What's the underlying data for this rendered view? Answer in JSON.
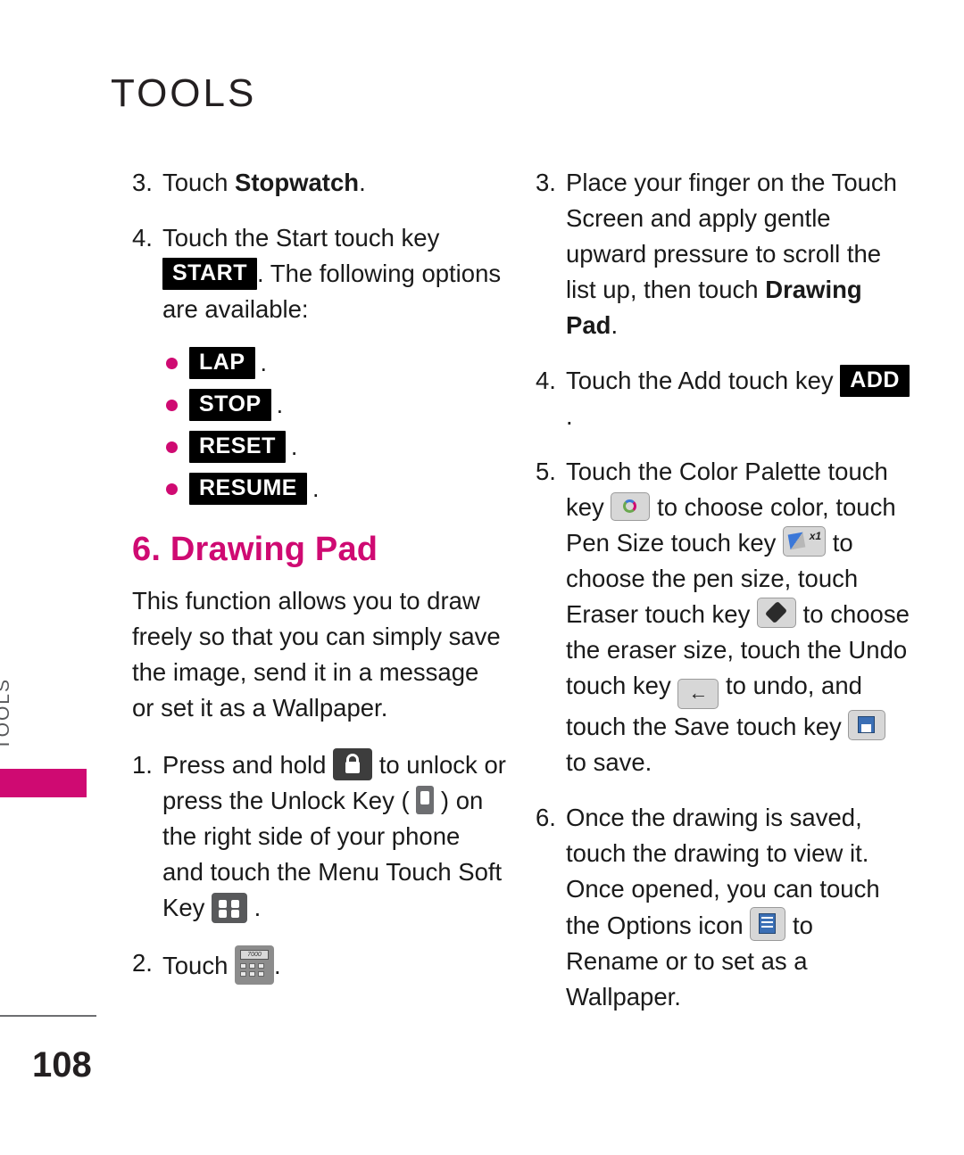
{
  "header": {
    "title": "TOOLS"
  },
  "side_tab": {
    "label": "TOOLS"
  },
  "footer": {
    "page_number": "108"
  },
  "left_column": {
    "steps": [
      {
        "num": "3.",
        "parts": [
          {
            "t": "text",
            "v": "Touch "
          },
          {
            "t": "bold",
            "v": "Stopwatch"
          },
          {
            "t": "text",
            "v": "."
          }
        ]
      },
      {
        "num": "4.",
        "parts": [
          {
            "t": "text",
            "v": "Touch the Start touch key "
          },
          {
            "t": "chip",
            "v": "START"
          },
          {
            "t": "text",
            "v": ". The following options are available:"
          }
        ]
      }
    ],
    "bullets": [
      {
        "label": "LAP"
      },
      {
        "label": "STOP"
      },
      {
        "label": "RESET"
      },
      {
        "label": "RESUME"
      }
    ],
    "section_heading": "6. Drawing Pad",
    "intro_paragraph": "This function allows you to draw freely so that you can simply save the image, send it in a message or set it as a Wallpaper.",
    "steps2": [
      {
        "num": "1.",
        "parts": [
          {
            "t": "text",
            "v": "Press and hold "
          },
          {
            "t": "icon",
            "v": "lock-icon"
          },
          {
            "t": "text",
            "v": " to unlock or press the Unlock Key ( "
          },
          {
            "t": "icon",
            "v": "unlock-key-icon"
          },
          {
            "t": "text",
            "v": " ) on the right side of your phone and touch the Menu Touch Soft Key "
          },
          {
            "t": "icon",
            "v": "menu-touch-soft-key-icon"
          },
          {
            "t": "text",
            "v": " ."
          }
        ]
      },
      {
        "num": "2.",
        "parts": [
          {
            "t": "text",
            "v": "Touch "
          },
          {
            "t": "icon",
            "v": "tools-icon"
          },
          {
            "t": "text",
            "v": "."
          }
        ]
      }
    ]
  },
  "right_column": {
    "steps": [
      {
        "num": "3.",
        "parts": [
          {
            "t": "text",
            "v": "Place your finger on the Touch Screen and apply gentle upward pressure to scroll the list up, then touch "
          },
          {
            "t": "bold",
            "v": "Drawing Pad"
          },
          {
            "t": "text",
            "v": "."
          }
        ]
      },
      {
        "num": "4.",
        "parts": [
          {
            "t": "text",
            "v": "Touch the Add touch key "
          },
          {
            "t": "chip",
            "v": "ADD"
          },
          {
            "t": "text",
            "v": " ."
          }
        ]
      },
      {
        "num": "5.",
        "parts": [
          {
            "t": "text",
            "v": "Touch the Color Palette touch key "
          },
          {
            "t": "icon",
            "v": "color-palette-icon"
          },
          {
            "t": "text",
            "v": " to choose color, touch Pen Size touch key "
          },
          {
            "t": "icon",
            "v": "pen-size-icon"
          },
          {
            "t": "text",
            "v": " to choose the pen size, touch Eraser touch key "
          },
          {
            "t": "icon",
            "v": "eraser-icon"
          },
          {
            "t": "text",
            "v": " to choose the eraser size, touch the Undo touch key "
          },
          {
            "t": "icon",
            "v": "undo-icon"
          },
          {
            "t": "text",
            "v": " to undo, and touch the Save touch key "
          },
          {
            "t": "icon",
            "v": "save-icon"
          },
          {
            "t": "text",
            "v": " to save."
          }
        ]
      },
      {
        "num": "6.",
        "parts": [
          {
            "t": "text",
            "v": "Once the drawing is saved, touch the drawing to view it. Once opened, you can touch the Options icon "
          },
          {
            "t": "icon",
            "v": "options-icon"
          },
          {
            "t": "text",
            "v": " to Rename or to set as a Wallpaper."
          }
        ]
      }
    ]
  },
  "colors": {
    "accent": "#cf0a72",
    "text": "#1a1a1a",
    "header": "#231f20"
  }
}
